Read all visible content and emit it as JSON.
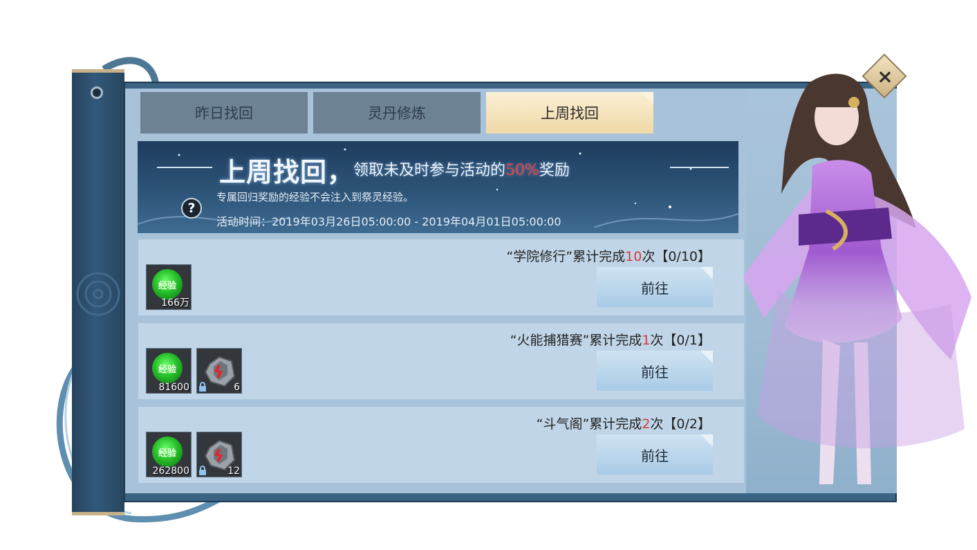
{
  "tabs": [
    {
      "label": "昨日找回",
      "active": false
    },
    {
      "label": "灵丹修炼",
      "active": false
    },
    {
      "label": "上周找回",
      "active": true
    }
  ],
  "banner": {
    "title": "上周找回，",
    "subtitle_pre": "领取未及时参与活动的",
    "subtitle_pct": "50%",
    "subtitle_post": "奖励",
    "note": "专属回归奖励的经验不会注入到祭灵经验。",
    "time": "活动时间：2019年03月26日05:00:00 - 2019年04月01日05:00:00",
    "help_symbol": "?"
  },
  "tasks": [
    {
      "desc_pre": "“学院修行”累计完成",
      "count": "10",
      "desc_post": "次【0/10】",
      "button": "前往",
      "rewards": [
        {
          "type": "exp",
          "label": "经验",
          "qty": "166万"
        }
      ]
    },
    {
      "desc_pre": "“火能捕猎赛”累计完成",
      "count": "1",
      "desc_post": "次【0/1】",
      "button": "前往",
      "rewards": [
        {
          "type": "exp",
          "label": "经验",
          "qty": "81600"
        },
        {
          "type": "stone",
          "qty": "6",
          "locked": true
        }
      ]
    },
    {
      "desc_pre": "“斗气阁”累计完成",
      "count": "2",
      "desc_post": "次【0/2】",
      "button": "前往",
      "rewards": [
        {
          "type": "exp",
          "label": "经验",
          "qty": "262800"
        },
        {
          "type": "stone",
          "qty": "12",
          "locked": true
        }
      ]
    }
  ],
  "close_symbol": "×",
  "colors": {
    "panel": "#3b6382",
    "tab_active": "#f0d8a6",
    "highlight_red": "#ff3b3b",
    "exp_green": "#28c02a"
  }
}
